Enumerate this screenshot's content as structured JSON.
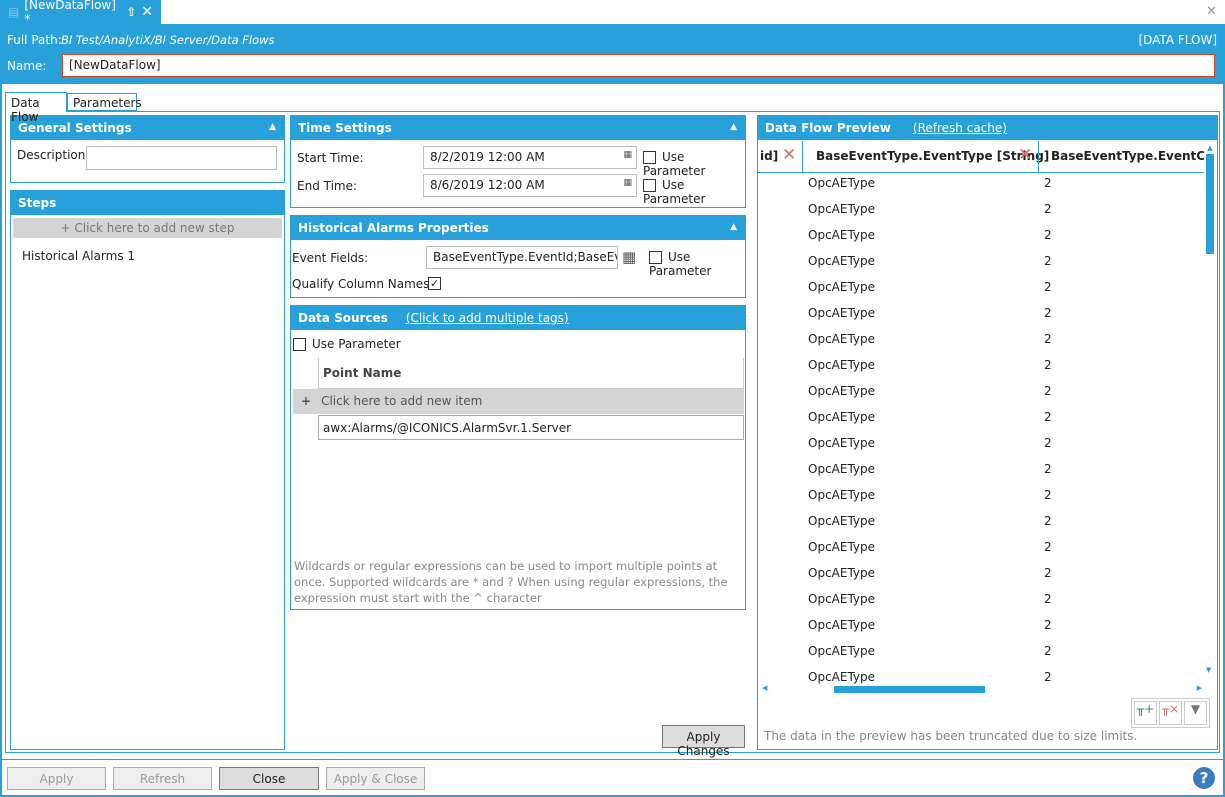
{
  "document_tab": {
    "title": "[NewDataFlow] *"
  },
  "header": {
    "full_path_label": "Full Path:",
    "full_path": "BI Test/AnalytiX/BI Server/Data Flows",
    "type_badge": "[DATA FLOW]",
    "name_label": "Name:",
    "name_value": "[NewDataFlow]"
  },
  "tabs": [
    {
      "label": "Data Flow"
    },
    {
      "label": "Parameters"
    }
  ],
  "general": {
    "title": "General Settings",
    "description_label": "Description:",
    "description_value": ""
  },
  "steps": {
    "title": "Steps",
    "add_label": "+ Click here to add new step",
    "items": [
      {
        "label": "Historical Alarms  1"
      }
    ]
  },
  "time": {
    "title": "Time Settings",
    "start_label": "Start Time:",
    "start_value": "8/2/2019 12:00 AM",
    "end_label": "End Time:",
    "end_value": "8/6/2019 12:00 AM",
    "use_param": "Use Parameter"
  },
  "hist": {
    "title": "Historical Alarms Properties",
    "event_fields_label": "Event Fields:",
    "event_fields_value": "BaseEventType.EventId;BaseEventT",
    "use_param": "Use Parameter",
    "qualify_label": "Qualify Column Names:"
  },
  "sources": {
    "title": "Data Sources",
    "link": "(Click to add multiple tags)",
    "use_param": "Use Parameter",
    "column": "Point Name",
    "add_label": "Click here to add new item",
    "items": [
      "awx:Alarms/@ICONICS.AlarmSvr.1.Server"
    ],
    "hint": "Wildcards or regular expressions can be used to import multiple points at once. Supported wildcards are * and ? When using regular expressions, the expression must start with the ^ character"
  },
  "apply_changes": "Apply Changes",
  "preview": {
    "title": "Data Flow Preview",
    "refresh": "(Refresh cache)",
    "columns": [
      "id]",
      "BaseEventType.EventType  [String]",
      "BaseEventType.EventClass"
    ],
    "rows": [
      [
        "OpcAEType",
        "2"
      ],
      [
        "OpcAEType",
        "2"
      ],
      [
        "OpcAEType",
        "2"
      ],
      [
        "OpcAEType",
        "2"
      ],
      [
        "OpcAEType",
        "2"
      ],
      [
        "OpcAEType",
        "2"
      ],
      [
        "OpcAEType",
        "2"
      ],
      [
        "OpcAEType",
        "2"
      ],
      [
        "OpcAEType",
        "2"
      ],
      [
        "OpcAEType",
        "2"
      ],
      [
        "OpcAEType",
        "2"
      ],
      [
        "OpcAEType",
        "2"
      ],
      [
        "OpcAEType",
        "2"
      ],
      [
        "OpcAEType",
        "2"
      ],
      [
        "OpcAEType",
        "2"
      ],
      [
        "OpcAEType",
        "2"
      ],
      [
        "OpcAEType",
        "2"
      ],
      [
        "OpcAEType",
        "2"
      ],
      [
        "OpcAEType",
        "2"
      ],
      [
        "OpcAEType",
        "2"
      ]
    ],
    "truncated": "The data in the preview has been truncated due to size limits."
  },
  "footer": {
    "apply": "Apply",
    "refresh": "Refresh",
    "close": "Close",
    "apply_close": "Apply & Close"
  }
}
